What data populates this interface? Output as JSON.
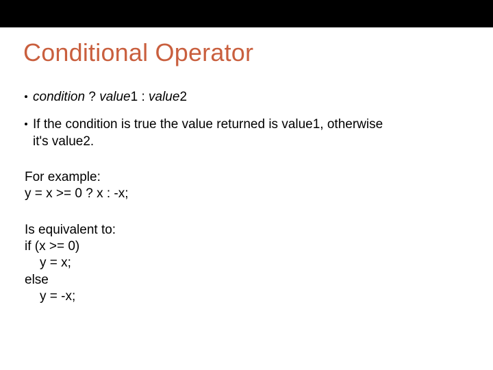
{
  "title": "Conditional Operator",
  "bullets": [
    {
      "syntax": {
        "cond": "condition",
        "mid": " ? ",
        "v1": "value",
        "one": "1 : ",
        "v2": "value",
        "two": "2"
      }
    },
    {
      "line1": "If the condition is true the value returned is value1, otherwise",
      "line2": "it's value2."
    }
  ],
  "example": {
    "intro": "For example:",
    "code": "y = x >= 0 ? x : -x;"
  },
  "equivalent": {
    "intro": "Is equivalent to:",
    "lines": [
      {
        "text": "if (x >= 0)",
        "indent": false
      },
      {
        "text": "y = x;",
        "indent": true
      },
      {
        "text": "else",
        "indent": false
      },
      {
        "text": "y = -x;",
        "indent": true
      }
    ]
  }
}
